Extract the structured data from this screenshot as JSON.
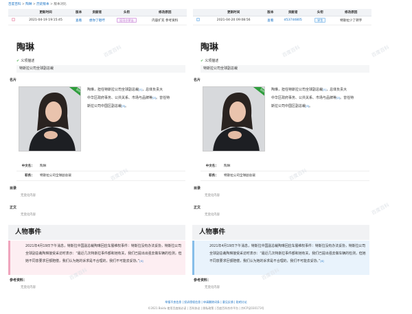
{
  "breadcrumb": {
    "root": "百度百科",
    "sep": ">",
    "person": "陶琳",
    "history": "历史版本",
    "current": "版本对比"
  },
  "table": {
    "headers": [
      "更新时间",
      "版本",
      "贡献者",
      "头衔",
      "修改原因"
    ]
  },
  "left": {
    "time": "2021-04-19 19:15:45",
    "version": "查看",
    "contributor": "想你了嗯哼",
    "title_tag": "见习小学士",
    "reason": "内容扩充 参考资料",
    "event_text": "2021年4月19日下午消息，特斯拉中国副总裁陶琳回应车展维权事件：特斯拉没有办法妥协，特斯拉公司全球副总裁陶琳接受采访时表示：“最近几次特斯拉事件都和她有关，我们已提出出强去做车辆的检测，但她不同意要求巨额赔偿，我们认为她的诉求是不合理的，我们不可能去妥协。”"
  },
  "right": {
    "time": "2021-04-20 09:08:56",
    "version": "查看",
    "contributor": "d53744805",
    "title_tag": "学生",
    "reason": "特斯拉少了转字",
    "event_text": "2021年4月19日下午消息，特斯拉中国副总裁陶琳回应车展维权事件：特斯拉没有办法妥协，特斯拉公司全球副总裁陶琳接受采访时表示：“最近几次特斯拉事件都和她有关，我们已提出强去做车辆的检测，但她不同意要求巨额赔偿，我们认为她的诉求是不合理的，我们不可能去妥协。”"
  },
  "article": {
    "name": "陶琳",
    "sense_label": "义项描述",
    "sense": "特斯拉公司全球副总裁",
    "photo_label": "名片",
    "badge": "百科",
    "intro": "陶琳，担任特斯拉公司全球副总裁[1]，总体负责大中华区政府事务、公共关系、市场与品牌等[2]。曾任特斯拉公司中国区副总裁[3]。",
    "intro_l1": "陶琳，担任特斯拉公司全球副总裁",
    "sup1": "[1]",
    "intro_l1b": "，总体负责大",
    "intro_l2": "中华区政府事务、公共关系、市场与品牌等",
    "sup2": "[2]",
    "intro_l2b": "。曾任特",
    "intro_l3": "斯拉公司中国区副总裁",
    "sup3": "[3]",
    "intro_l3b": "。",
    "k_name": "中文名：",
    "v_name": "陶琳",
    "k_job": "职务：",
    "v_job": "特斯拉公司全球副总裁",
    "toc": "目录",
    "body": "正文",
    "refs": "参考资料：",
    "none": "无变化内容",
    "section": "人物事件",
    "cite": "[4]"
  },
  "watermark": "百度百科",
  "footer": {
    "links": "举报不良信息 | 投诉侵权信息 | 申请删除词条 | 意见反馈 | 贴吧讨论",
    "copyright": "©2021 Baidu 使用百度前必读 | 百科协议 | 隐私政策 | 百度百科合作平台 | 京ICP证030173号"
  }
}
